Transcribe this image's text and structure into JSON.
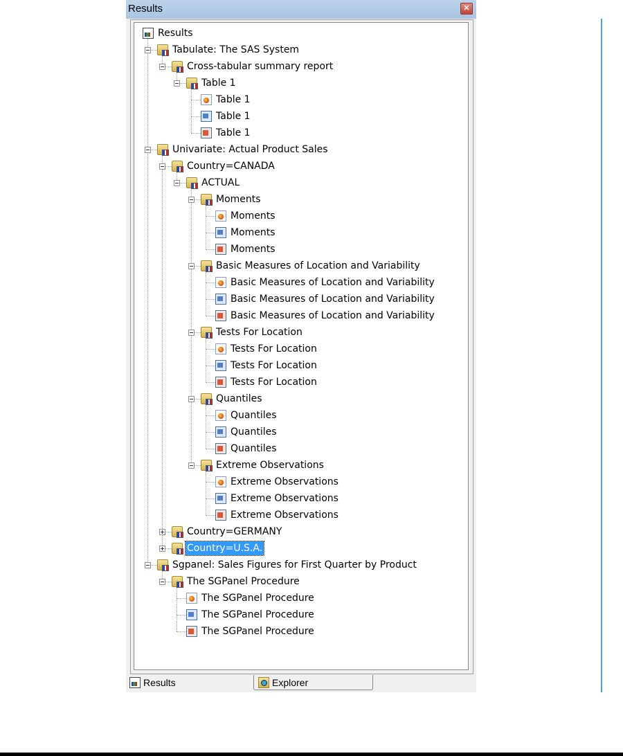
{
  "window": {
    "title": "Results",
    "close_icon": "close-icon"
  },
  "tree": {
    "nodes": [
      {
        "label": "Results",
        "icon": "results-icon",
        "level": 0,
        "expander": "none"
      },
      {
        "label": "Tabulate:  The SAS System",
        "icon": "folder-icon",
        "level": 1,
        "expander": "minus"
      },
      {
        "label": "Cross-tabular summary report",
        "icon": "folder-icon",
        "level": 2,
        "expander": "minus"
      },
      {
        "label": "Table 1",
        "icon": "folder-icon",
        "level": 3,
        "expander": "minus"
      },
      {
        "label": "Table 1",
        "icon": "html-output-icon",
        "level": 4,
        "expander": "none"
      },
      {
        "label": "Table 1",
        "icon": "rtf-output-icon",
        "level": 4,
        "expander": "none"
      },
      {
        "label": "Table 1",
        "icon": "pdf-output-icon",
        "level": 4,
        "expander": "none"
      },
      {
        "label": "Univariate:  Actual Product Sales",
        "icon": "folder-icon",
        "level": 1,
        "expander": "minus"
      },
      {
        "label": "Country=CANADA",
        "icon": "folder-icon",
        "level": 2,
        "expander": "minus"
      },
      {
        "label": "ACTUAL",
        "icon": "folder-icon",
        "level": 3,
        "expander": "minus"
      },
      {
        "label": "Moments",
        "icon": "folder-icon",
        "level": 4,
        "expander": "minus"
      },
      {
        "label": "Moments",
        "icon": "html-output-icon",
        "level": 5,
        "expander": "none"
      },
      {
        "label": "Moments",
        "icon": "rtf-output-icon",
        "level": 5,
        "expander": "none"
      },
      {
        "label": "Moments",
        "icon": "pdf-output-icon",
        "level": 5,
        "expander": "none"
      },
      {
        "label": "Basic Measures of Location and Variability",
        "icon": "folder-icon",
        "level": 4,
        "expander": "minus"
      },
      {
        "label": "Basic Measures of Location and Variability",
        "icon": "html-output-icon",
        "level": 5,
        "expander": "none"
      },
      {
        "label": "Basic Measures of Location and Variability",
        "icon": "rtf-output-icon",
        "level": 5,
        "expander": "none"
      },
      {
        "label": "Basic Measures of Location and Variability",
        "icon": "pdf-output-icon",
        "level": 5,
        "expander": "none"
      },
      {
        "label": "Tests For Location",
        "icon": "folder-icon",
        "level": 4,
        "expander": "minus"
      },
      {
        "label": "Tests For Location",
        "icon": "html-output-icon",
        "level": 5,
        "expander": "none"
      },
      {
        "label": "Tests For Location",
        "icon": "rtf-output-icon",
        "level": 5,
        "expander": "none"
      },
      {
        "label": "Tests For Location",
        "icon": "pdf-output-icon",
        "level": 5,
        "expander": "none"
      },
      {
        "label": "Quantiles",
        "icon": "folder-icon",
        "level": 4,
        "expander": "minus"
      },
      {
        "label": "Quantiles",
        "icon": "html-output-icon",
        "level": 5,
        "expander": "none"
      },
      {
        "label": "Quantiles",
        "icon": "rtf-output-icon",
        "level": 5,
        "expander": "none"
      },
      {
        "label": "Quantiles",
        "icon": "pdf-output-icon",
        "level": 5,
        "expander": "none"
      },
      {
        "label": "Extreme Observations",
        "icon": "folder-icon",
        "level": 4,
        "expander": "minus"
      },
      {
        "label": "Extreme Observations",
        "icon": "html-output-icon",
        "level": 5,
        "expander": "none"
      },
      {
        "label": "Extreme Observations",
        "icon": "rtf-output-icon",
        "level": 5,
        "expander": "none"
      },
      {
        "label": "Extreme Observations",
        "icon": "pdf-output-icon",
        "level": 5,
        "expander": "none"
      },
      {
        "label": "Country=GERMANY",
        "icon": "folder-icon",
        "level": 2,
        "expander": "plus"
      },
      {
        "label": "Country=U.S.A.",
        "icon": "folder-icon",
        "level": 2,
        "expander": "plus",
        "selected": true
      },
      {
        "label": "Sgpanel:  Sales Figures for First Quarter by Product",
        "icon": "folder-icon",
        "level": 1,
        "expander": "minus"
      },
      {
        "label": "The SGPanel Procedure",
        "icon": "folder-icon",
        "level": 2,
        "expander": "minus"
      },
      {
        "label": "The SGPanel Procedure",
        "icon": "html-output-icon",
        "level": 3,
        "expander": "none"
      },
      {
        "label": "The SGPanel Procedure",
        "icon": "rtf-output-icon",
        "level": 3,
        "expander": "none"
      },
      {
        "label": "The SGPanel Procedure",
        "icon": "pdf-output-icon",
        "level": 3,
        "expander": "none"
      }
    ]
  },
  "tabs": [
    {
      "label": "Results",
      "icon": "results-icon",
      "active": true
    },
    {
      "label": "Explorer",
      "icon": "explorer-icon",
      "active": false
    }
  ],
  "selection_color": "#3399ff"
}
